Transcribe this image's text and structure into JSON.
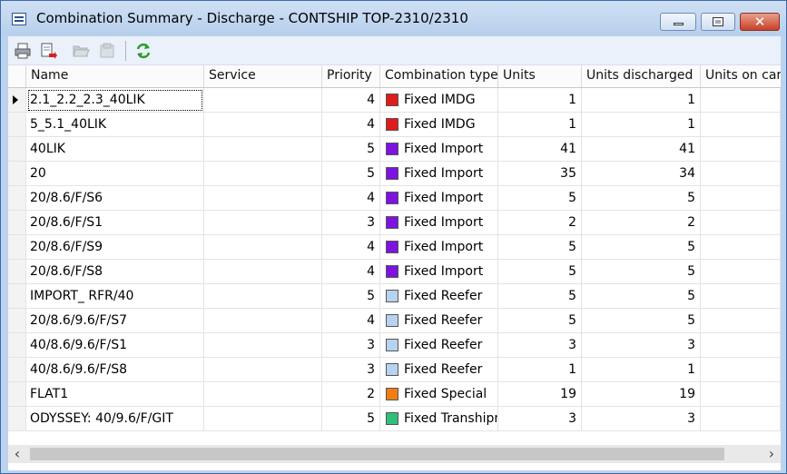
{
  "window": {
    "title": "Combination Summary - Discharge - CONTSHIP TOP-2310/2310",
    "controls": {
      "minimize": "minimize",
      "maximize": "maximize",
      "close": "✕"
    }
  },
  "toolbar": {
    "icons": [
      "print-icon",
      "export-icon",
      "open-icon",
      "properties-icon",
      "refresh-icon"
    ]
  },
  "grid": {
    "columns": [
      "Name",
      "Service",
      "Priority",
      "Combination type",
      "Units",
      "Units discharged",
      "Units on carrier"
    ],
    "rows": [
      {
        "name": "2.1_2.2_2.3_40LIK",
        "service": "",
        "priority": "4",
        "ctype": "Fixed IMDG",
        "color": "#e01b1b",
        "units": "1",
        "discharged": "1",
        "on_carrier": ""
      },
      {
        "name": "5_5.1_40LIK",
        "service": "",
        "priority": "4",
        "ctype": "Fixed IMDG",
        "color": "#e01b1b",
        "units": "1",
        "discharged": "1",
        "on_carrier": ""
      },
      {
        "name": "40LIK",
        "service": "",
        "priority": "5",
        "ctype": "Fixed Import",
        "color": "#7e12e0",
        "units": "41",
        "discharged": "41",
        "on_carrier": ""
      },
      {
        "name": "20",
        "service": "",
        "priority": "5",
        "ctype": "Fixed Import",
        "color": "#7e12e0",
        "units": "35",
        "discharged": "34",
        "on_carrier": ""
      },
      {
        "name": "20/8.6/F/S6",
        "service": "",
        "priority": "4",
        "ctype": "Fixed Import",
        "color": "#7e12e0",
        "units": "5",
        "discharged": "5",
        "on_carrier": ""
      },
      {
        "name": "20/8.6/F/S1",
        "service": "",
        "priority": "3",
        "ctype": "Fixed Import",
        "color": "#7e12e0",
        "units": "2",
        "discharged": "2",
        "on_carrier": ""
      },
      {
        "name": "20/8.6/F/S9",
        "service": "",
        "priority": "4",
        "ctype": "Fixed Import",
        "color": "#7e12e0",
        "units": "5",
        "discharged": "5",
        "on_carrier": ""
      },
      {
        "name": "20/8.6/F/S8",
        "service": "",
        "priority": "4",
        "ctype": "Fixed Import",
        "color": "#7e12e0",
        "units": "5",
        "discharged": "5",
        "on_carrier": ""
      },
      {
        "name": "IMPORT_ RFR/40",
        "service": "",
        "priority": "5",
        "ctype": "Fixed Reefer",
        "color": "#b6d3f2",
        "units": "5",
        "discharged": "5",
        "on_carrier": ""
      },
      {
        "name": "20/8.6/9.6/F/S7",
        "service": "",
        "priority": "4",
        "ctype": "Fixed Reefer",
        "color": "#b6d3f2",
        "units": "5",
        "discharged": "5",
        "on_carrier": ""
      },
      {
        "name": "40/8.6/9.6/F/S1",
        "service": "",
        "priority": "3",
        "ctype": "Fixed Reefer",
        "color": "#b6d3f2",
        "units": "3",
        "discharged": "3",
        "on_carrier": ""
      },
      {
        "name": "40/8.6/9.6/F/S8",
        "service": "",
        "priority": "3",
        "ctype": "Fixed Reefer",
        "color": "#b6d3f2",
        "units": "1",
        "discharged": "1",
        "on_carrier": ""
      },
      {
        "name": "FLAT1",
        "service": "",
        "priority": "2",
        "ctype": "Fixed Special",
        "color": "#f07d12",
        "units": "19",
        "discharged": "19",
        "on_carrier": ""
      },
      {
        "name": "ODYSSEY: 40/9.6/F/GIT",
        "service": "",
        "priority": "5",
        "ctype": "Fixed Transhipment",
        "color": "#2fbf78",
        "units": "3",
        "discharged": "3",
        "on_carrier": ""
      }
    ]
  },
  "scrollbar": {
    "left": "‹",
    "right": "›"
  }
}
